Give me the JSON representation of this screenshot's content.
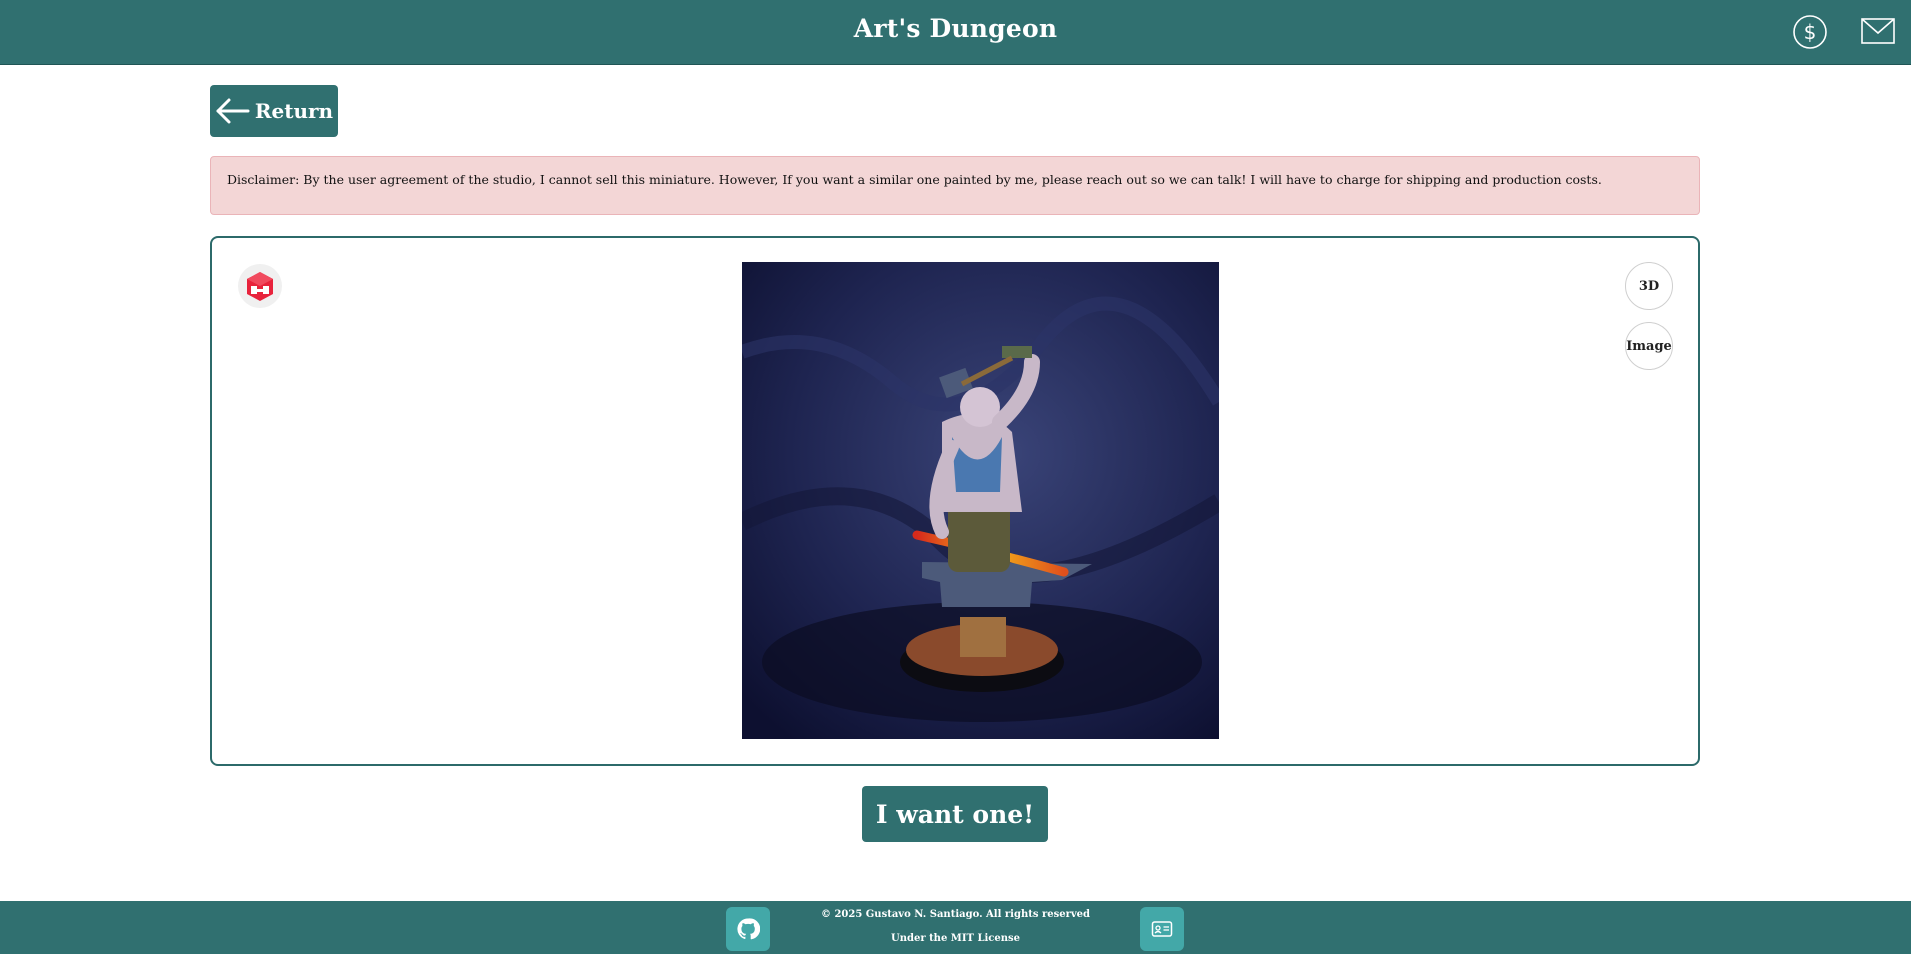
{
  "header": {
    "title": "Art's Dungeon",
    "icons": [
      "dollar-icon",
      "mail-icon"
    ]
  },
  "nav": {
    "return_label": "Return"
  },
  "disclaimer": {
    "text": "Disclaimer: By the user agreement of the studio, I cannot sell this miniature. However, If you want a similar one painted by me, please reach out so we can talk! I will have to charge for shipping and production costs."
  },
  "viewer": {
    "badge_icon": "ar-cube-icon",
    "toggle_3d": "3D",
    "toggle_image": "Image",
    "image_alt": "Painted miniature of a blacksmith with hammer at an anvil"
  },
  "cta": {
    "label": "I want one!"
  },
  "footer": {
    "copyright": "© 2025 Gustavo N. Santiago. All rights reserved",
    "license": "Under the MIT License",
    "icons": [
      "github-icon",
      "contact-card-icon"
    ]
  },
  "colors": {
    "primary": "#307070",
    "disclaimer_bg": "#f3d6d6",
    "footer_button": "#43a8a8"
  }
}
